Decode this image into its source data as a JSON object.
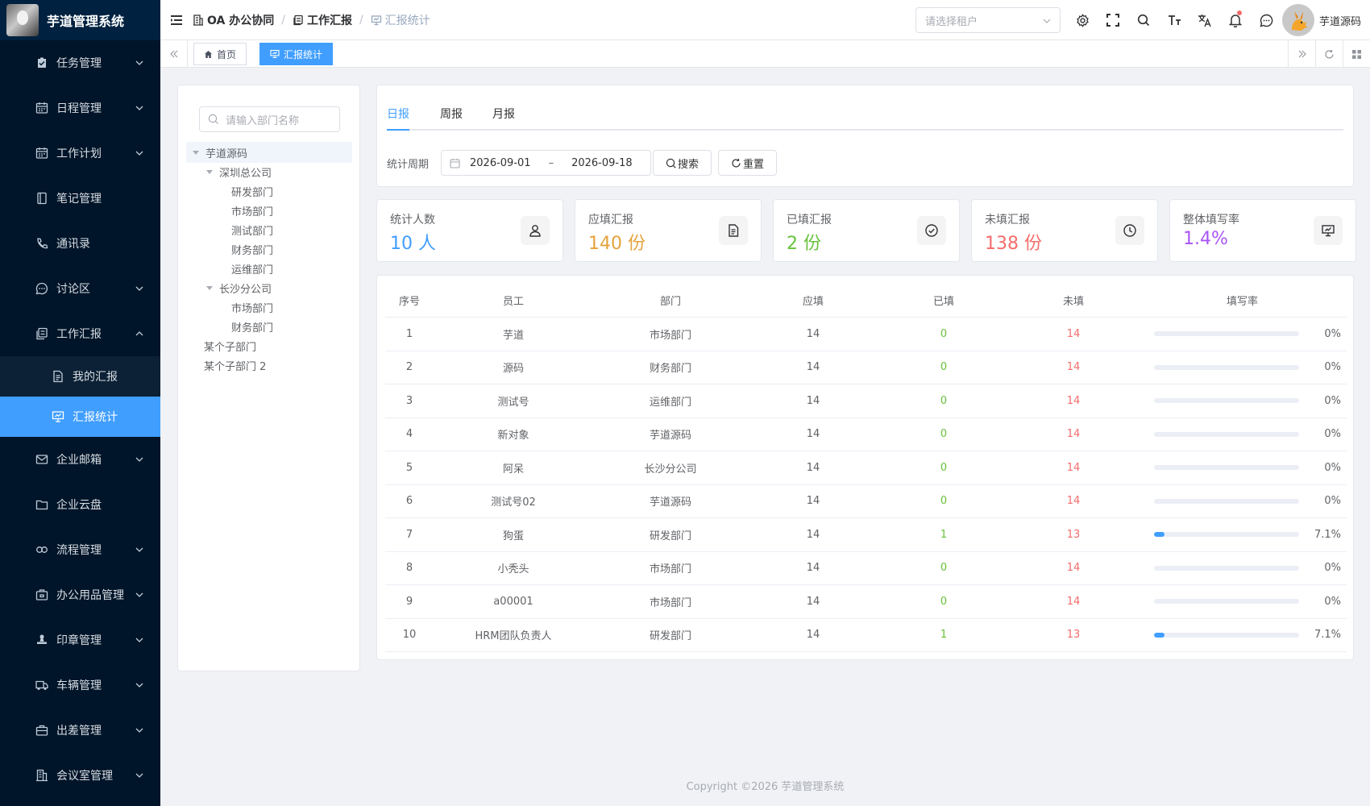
{
  "app": {
    "title": "芋道管理系统"
  },
  "sidebar": {
    "items": [
      {
        "label": "任务管理",
        "icon": "task-icon",
        "expandable": true
      },
      {
        "label": "日程管理",
        "icon": "calendar-icon",
        "expandable": true
      },
      {
        "label": "工作计划",
        "icon": "calendar-icon",
        "expandable": true
      },
      {
        "label": "笔记管理",
        "icon": "notebook-icon",
        "expandable": false
      },
      {
        "label": "通讯录",
        "icon": "phone-icon",
        "expandable": false
      },
      {
        "label": "讨论区",
        "icon": "chat-icon",
        "expandable": true
      },
      {
        "label": "工作汇报",
        "icon": "report-icon",
        "expandable": true,
        "expanded": true
      },
      {
        "label": "我的汇报",
        "icon": "document-icon",
        "sub": true
      },
      {
        "label": "汇报统计",
        "icon": "presentation-icon",
        "sub": true,
        "active": true
      },
      {
        "label": "企业邮箱",
        "icon": "mail-icon",
        "expandable": true
      },
      {
        "label": "企业云盘",
        "icon": "folder-icon",
        "expandable": false
      },
      {
        "label": "流程管理",
        "icon": "flow-icon",
        "expandable": true
      },
      {
        "label": "办公用品管理",
        "icon": "supplies-icon",
        "expandable": true
      },
      {
        "label": "印章管理",
        "icon": "stamp-icon",
        "expandable": true
      },
      {
        "label": "车辆管理",
        "icon": "truck-icon",
        "expandable": true
      },
      {
        "label": "出差管理",
        "icon": "briefcase-icon",
        "expandable": true
      },
      {
        "label": "会议室管理",
        "icon": "building-icon",
        "expandable": true
      }
    ]
  },
  "header": {
    "breadcrumb": [
      "OA 办公协同",
      "工作汇报",
      "汇报统计"
    ],
    "tenant_placeholder": "请选择租户",
    "username": "芋道源码"
  },
  "tags": {
    "home": "首页",
    "current": "汇报统计"
  },
  "tree": {
    "search_placeholder": "请输入部门名称",
    "nodes": [
      {
        "label": "芋道源码",
        "level": 0,
        "caret": true,
        "selected": true
      },
      {
        "label": "深圳总公司",
        "level": 1,
        "caret": true
      },
      {
        "label": "研发部门",
        "level": 2
      },
      {
        "label": "市场部门",
        "level": 2
      },
      {
        "label": "测试部门",
        "level": 2
      },
      {
        "label": "财务部门",
        "level": 2
      },
      {
        "label": "运维部门",
        "level": 2
      },
      {
        "label": "长沙分公司",
        "level": 1,
        "caret": true
      },
      {
        "label": "市场部门",
        "level": 2
      },
      {
        "label": "财务部门",
        "level": 2
      },
      {
        "label": "某个子部门",
        "level": 0
      },
      {
        "label": "某个子部门 2",
        "level": 0
      }
    ]
  },
  "query": {
    "tabs": [
      "日报",
      "周报",
      "月报"
    ],
    "active_tab": 0,
    "period_label": "统计周期",
    "start_date": "2026-09-01",
    "range_sep": "–",
    "end_date": "2026-09-18",
    "search_label": "搜索",
    "reset_label": "重置"
  },
  "stats": [
    {
      "label": "统计人数",
      "value": "10 人",
      "color": "#409eff",
      "icon": "user-icon"
    },
    {
      "label": "应填汇报",
      "value": "140 份",
      "color": "#e6a23c",
      "icon": "document-icon"
    },
    {
      "label": "已填汇报",
      "value": "2 份",
      "color": "#67c23a",
      "icon": "check-circle-icon"
    },
    {
      "label": "未填汇报",
      "value": "138 份",
      "color": "#f56c6c",
      "icon": "clock-icon"
    },
    {
      "label": "整体填写率",
      "value": "1.4%",
      "color": "#a855f7",
      "icon": "presentation-icon"
    }
  ],
  "table": {
    "columns": [
      "序号",
      "员工",
      "部门",
      "应填",
      "已填",
      "未填",
      "填写率"
    ],
    "rows": [
      {
        "no": "1",
        "name": "芋道",
        "dept": "市场部门",
        "due": "14",
        "done": "0",
        "todo": "14",
        "rate": "0%",
        "fraction": 0
      },
      {
        "no": "2",
        "name": "源码",
        "dept": "财务部门",
        "due": "14",
        "done": "0",
        "todo": "14",
        "rate": "0%",
        "fraction": 0
      },
      {
        "no": "3",
        "name": "测试号",
        "dept": "运维部门",
        "due": "14",
        "done": "0",
        "todo": "14",
        "rate": "0%",
        "fraction": 0
      },
      {
        "no": "4",
        "name": "新对象",
        "dept": "芋道源码",
        "due": "14",
        "done": "0",
        "todo": "14",
        "rate": "0%",
        "fraction": 0
      },
      {
        "no": "5",
        "name": "阿呆",
        "dept": "长沙分公司",
        "due": "14",
        "done": "0",
        "todo": "14",
        "rate": "0%",
        "fraction": 0
      },
      {
        "no": "6",
        "name": "测试号02",
        "dept": "芋道源码",
        "due": "14",
        "done": "0",
        "todo": "14",
        "rate": "0%",
        "fraction": 0
      },
      {
        "no": "7",
        "name": "狗蛋",
        "dept": "研发部门",
        "due": "14",
        "done": "1",
        "todo": "13",
        "rate": "7.1%",
        "fraction": 0.071
      },
      {
        "no": "8",
        "name": "小秃头",
        "dept": "市场部门",
        "due": "14",
        "done": "0",
        "todo": "14",
        "rate": "0%",
        "fraction": 0
      },
      {
        "no": "9",
        "name": "a00001",
        "dept": "市场部门",
        "due": "14",
        "done": "0",
        "todo": "14",
        "rate": "0%",
        "fraction": 0
      },
      {
        "no": "10",
        "name": "HRM团队负责人",
        "dept": "研发部门",
        "due": "14",
        "done": "1",
        "todo": "13",
        "rate": "7.1%",
        "fraction": 0.071
      }
    ]
  },
  "footer": {
    "copyright": "Copyright ©2026 芋道管理系统"
  }
}
